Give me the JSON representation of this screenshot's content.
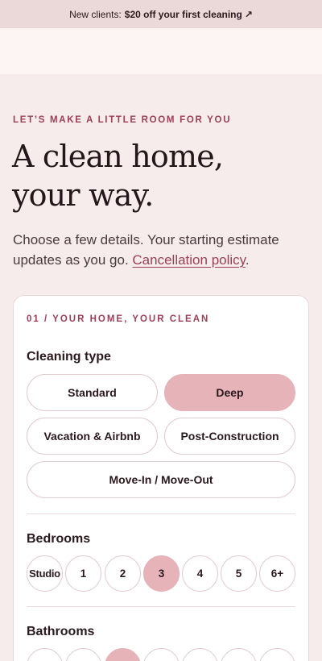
{
  "promo": {
    "prefix": "New clients:",
    "offer": "$20 off your first cleaning",
    "arrow": "↗"
  },
  "hero": {
    "eyebrow": "LET’S MAKE A LITTLE ROOM FOR YOU",
    "title_line1": "A clean home,",
    "title_line2": "your way.",
    "lede": "Choose a few details. Your starting estimate updates as you go.",
    "policy_link": "Cancellation policy",
    "lede_end": "."
  },
  "form": {
    "step": "01 / YOUR HOME, YOUR CLEAN",
    "cleaning_type": {
      "label": "Cleaning type",
      "options": [
        "Standard",
        "Deep",
        "Vacation & Airbnb",
        "Post-Construction",
        "Move-In / Move-Out"
      ],
      "selected": "Deep"
    },
    "bedrooms": {
      "label": "Bedrooms",
      "options": [
        "Studio",
        "1",
        "2",
        "3",
        "4",
        "5",
        "6+"
      ],
      "selected": "3"
    },
    "bathrooms": {
      "label": "Bathrooms"
    }
  },
  "colors": {
    "accent": "#9a3f58",
    "selected_fill": "#e5b3b8",
    "page_bg": "#f6eceb",
    "promo_bg": "#ebd8d8"
  }
}
